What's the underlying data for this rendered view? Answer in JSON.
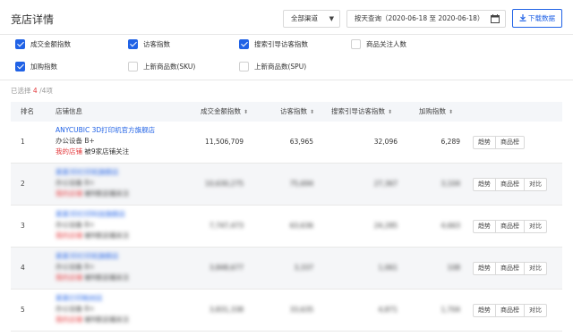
{
  "header": {
    "title": "竞店详情",
    "channel": "全部渠道",
    "date_range": "按天查询（2020-06-18 至 2020-06-18）",
    "download_label": "下载数据"
  },
  "metrics": [
    {
      "label": "成交金额指数",
      "checked": true
    },
    {
      "label": "访客指数",
      "checked": true
    },
    {
      "label": "搜索引导访客指数",
      "checked": true
    },
    {
      "label": "商品关注人数",
      "checked": false
    },
    {
      "label": "加购指数",
      "checked": true
    },
    {
      "label": "上新商品数(SKU)",
      "checked": false
    },
    {
      "label": "上新商品数(SPU)",
      "checked": false
    }
  ],
  "selection": {
    "prefix": "已选择",
    "count": "4",
    "suffix": "/4项"
  },
  "table": {
    "headers": [
      "排名",
      "店铺信息",
      "成交金额指数",
      "访客指数",
      "搜索引导访客指数",
      "加购指数"
    ],
    "rows": [
      {
        "rank": "1",
        "name": "ANYCUBIC 3D打印机官方旗舰店",
        "category": "办公设备 B+",
        "mine_tag": "我的店铺",
        "mine_text": "被9家店铺关注",
        "v1": "11,506,709",
        "v2": "63,965",
        "v3": "32,096",
        "v4": "6,289",
        "actions": [
          "趋势",
          "商品榜"
        ]
      },
      {
        "rank": "2",
        "name": "某某3D打印机旗舰店",
        "category": "办公设备 B+",
        "mine_tag": "我的店铺",
        "mine_text": "被9家店铺关注",
        "v1": "10,630,275",
        "v2": "75,694",
        "v3": "27,367",
        "v4": "3,104",
        "actions": [
          "趋势",
          "商品榜",
          "对比"
        ]
      },
      {
        "rank": "3",
        "name": "某某3D打印科技旗舰店",
        "category": "办公设备 B+",
        "mine_tag": "我的店铺",
        "mine_text": "被9家店铺关注",
        "v1": "7,747,473",
        "v2": "63,636",
        "v3": "24,285",
        "v4": "4,663",
        "actions": [
          "趋势",
          "商品榜",
          "对比"
        ]
      },
      {
        "rank": "4",
        "name": "某某3D打印机旗舰店",
        "category": "办公设备 B+",
        "mine_tag": "我的店铺",
        "mine_text": "被9家店铺关注",
        "v1": "3,848,677",
        "v2": "3,337",
        "v3": "1,061",
        "v4": "108",
        "actions": [
          "趋势",
          "商品榜",
          "对比"
        ]
      },
      {
        "rank": "5",
        "name": "某某打印耗材店",
        "category": "办公设备 B+",
        "mine_tag": "我的店铺",
        "mine_text": "被9家店铺关注",
        "v1": "3,831,338",
        "v2": "33,635",
        "v3": "4,871",
        "v4": "1,704",
        "actions": [
          "趋势",
          "商品榜",
          "对比"
        ]
      }
    ]
  }
}
